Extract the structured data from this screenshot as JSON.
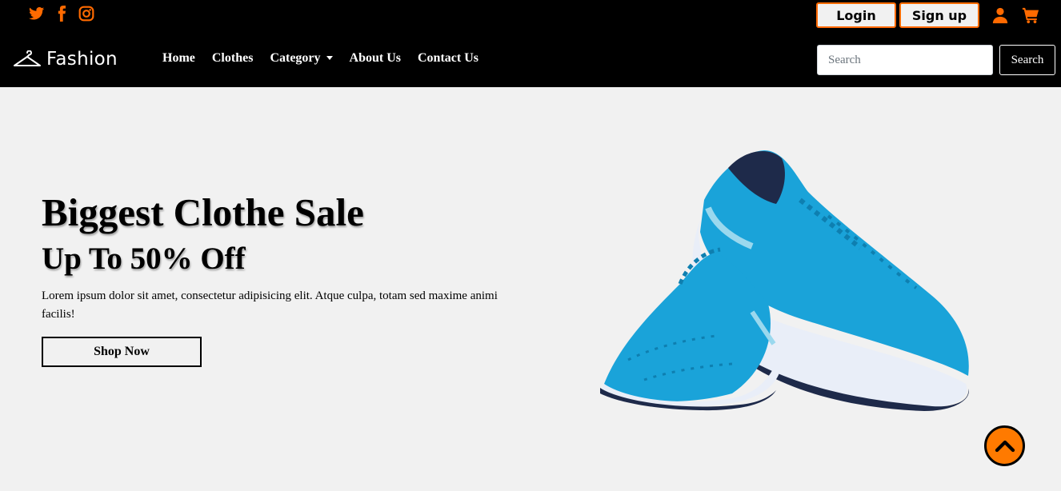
{
  "social": {
    "icons": [
      "twitter-icon",
      "facebook-icon",
      "instagram-icon"
    ],
    "color": "#ff6a00"
  },
  "auth": {
    "login_label": "Login",
    "signup_label": "Sign up",
    "icons": [
      "user-icon",
      "cart-icon"
    ]
  },
  "brand": {
    "name": "Fashion",
    "icon": "hanger-icon"
  },
  "nav": {
    "items": [
      {
        "label": "Home"
      },
      {
        "label": "Clothes"
      },
      {
        "label": "Category"
      },
      {
        "label": "About Us"
      },
      {
        "label": "Contact Us"
      }
    ]
  },
  "search": {
    "placeholder": "Search",
    "button_label": "Search"
  },
  "hero": {
    "title": "Biggest Clothe Sale",
    "subtitle": "Up To 50% Off",
    "description": "Lorem ipsum dolor sit amet, consectetur adipisicing elit. Atque culpa, totam sed maxime animi facilis!",
    "cta_label": "Shop Now"
  },
  "scroll_top": {
    "icon": "chevron-up-icon"
  },
  "colors": {
    "accent": "#ff6a00",
    "navbar": "#000000",
    "background": "#f1f1f1",
    "shoe_primary": "#1aa3d9"
  }
}
